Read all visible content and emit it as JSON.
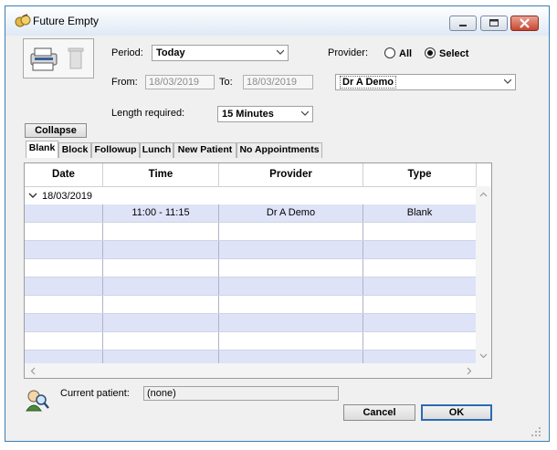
{
  "window": {
    "title": "Future Empty"
  },
  "period": {
    "label": "Period:",
    "value": "Today"
  },
  "provider": {
    "label": "Provider:",
    "all_label": "All",
    "select_label": "Select",
    "selected": "select",
    "value": "Dr A Demo"
  },
  "from": {
    "label": "From:",
    "value": "18/03/2019"
  },
  "to": {
    "label": "To:",
    "value": "18/03/2019"
  },
  "length": {
    "label": "Length required:",
    "value": "15 Minutes"
  },
  "collapse_label": "Collapse",
  "tabs": [
    "Blank",
    "Block",
    "Followup",
    "Lunch",
    "New Patient",
    "No Appointments"
  ],
  "grid": {
    "columns": [
      "Date",
      "Time",
      "Provider",
      "Type"
    ],
    "group": "18/03/2019",
    "rows": [
      {
        "date": "",
        "time": "11:00 - 11:15",
        "provider": "Dr A Demo",
        "type": "Blank"
      }
    ]
  },
  "current_patient": {
    "label": "Current patient:",
    "value": "(none)"
  },
  "buttons": {
    "cancel": "Cancel",
    "ok": "OK"
  },
  "colors": {
    "row_alt": "#dfe3f8",
    "ok_border": "#2e6bb3",
    "title_border": "#3c7fb1"
  }
}
